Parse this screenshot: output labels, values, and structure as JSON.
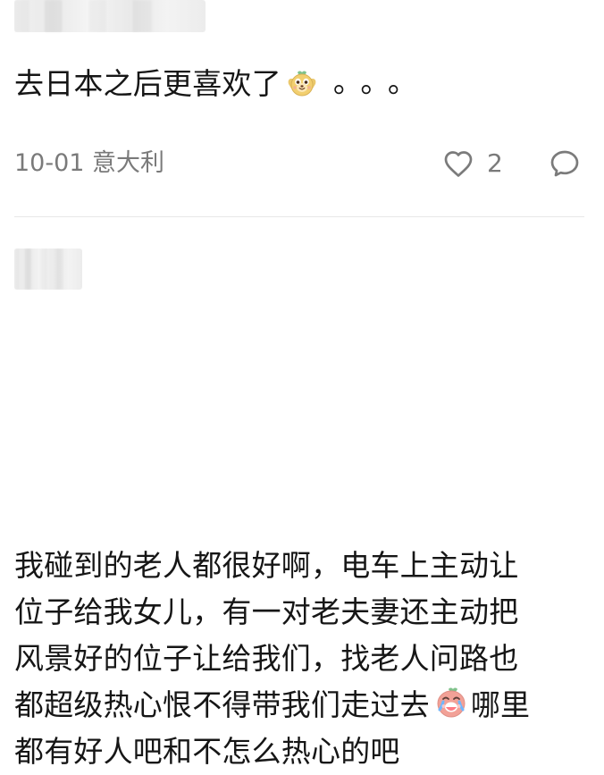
{
  "comments": [
    {
      "text_main": "去日本之后更喜欢了",
      "dots": "。。。",
      "date_location": "10-01 意大利",
      "like_count": "2",
      "icons": [
        "dog-sticker-icon",
        "heart-icon",
        "comment-bubble-icon"
      ]
    },
    {
      "lines": [
        "我碰到的老人都很好啊，电车上主动让",
        "位子给我女儿，有一对老夫妻还主动把",
        "风景好的位子让给我们，找老人问路也",
        "都超级热心恨不得带我们走过去",
        "都有好人吧和不怎么热心的吧"
      ],
      "line4_suffix": "哪里",
      "icons": [
        "teary-sticker-icon"
      ]
    }
  ],
  "colors": {
    "text": "#161616",
    "meta": "#7a7a7a",
    "divider": "#e7e7e7",
    "icon": "#7b7b7b"
  }
}
